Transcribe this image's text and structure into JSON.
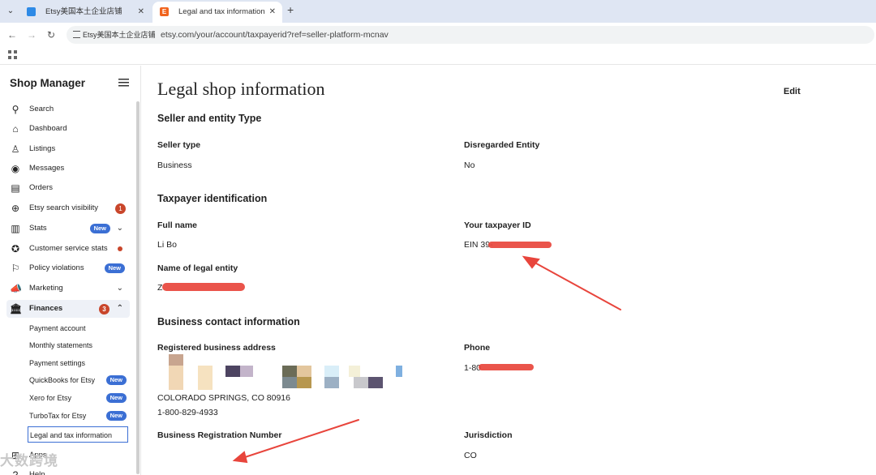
{
  "browser": {
    "tabs": [
      {
        "label": "Etsy美国本土企业店铺",
        "active": false
      },
      {
        "label": "Legal and tax information",
        "active": true
      }
    ],
    "site_chip": "Etsy美国本土企业店铺",
    "url": "etsy.com/your/account/taxpayerid?ref=seller-platform-mcnav"
  },
  "sidebar": {
    "title": "Shop Manager",
    "items": [
      {
        "label": "Search",
        "icon": "search-icon"
      },
      {
        "label": "Dashboard",
        "icon": "home-icon"
      },
      {
        "label": "Listings",
        "icon": "listings-icon"
      },
      {
        "label": "Messages",
        "icon": "messages-icon"
      },
      {
        "label": "Orders",
        "icon": "orders-icon"
      },
      {
        "label": "Etsy search visibility",
        "icon": "search-visibility-icon",
        "badge": "1"
      },
      {
        "label": "Stats",
        "icon": "stats-icon",
        "badge": "New"
      },
      {
        "label": "Customer service stats",
        "icon": "customer-service-icon"
      },
      {
        "label": "Policy violations",
        "icon": "flag-icon",
        "badge": "New"
      },
      {
        "label": "Marketing",
        "icon": "megaphone-icon"
      },
      {
        "label": "Finances",
        "icon": "bank-icon",
        "badge": "3"
      }
    ],
    "finance_sub": [
      {
        "label": "Payment account"
      },
      {
        "label": "Monthly statements"
      },
      {
        "label": "Payment settings"
      },
      {
        "label": "QuickBooks for Etsy",
        "badge": "New"
      },
      {
        "label": "Xero for Etsy",
        "badge": "New"
      },
      {
        "label": "TurboTax for Etsy",
        "badge": "New"
      },
      {
        "label": "Legal and tax information"
      }
    ],
    "apps_label": "Apps",
    "help_label": "Help"
  },
  "main": {
    "title": "Legal shop information",
    "edit_label": "Edit",
    "seller_section": {
      "title": "Seller and entity Type",
      "seller_type_label": "Seller type",
      "seller_type_value": "Business",
      "disregarded_label": "Disregarded Entity",
      "disregarded_value": "No"
    },
    "taxpayer_section": {
      "title": "Taxpayer identification",
      "full_name_label": "Full name",
      "full_name_value": "Li Bo",
      "taxpayer_id_label": "Your taxpayer ID",
      "taxpayer_id_value": "EIN 39-",
      "legal_entity_label": "Name of legal entity",
      "legal_entity_value": "Z"
    },
    "contact_section": {
      "title": "Business contact information",
      "address_label": "Registered business address",
      "address_city": "COLORADO SPRINGS, CO 80916",
      "address_phone": "1-800-829-4933",
      "phone_label": "Phone",
      "phone_value": "1-80",
      "brn_label": "Business Registration Number",
      "jurisdiction_label": "Jurisdiction",
      "jurisdiction_value": "CO"
    }
  },
  "watermark": "大数跨境",
  "colors": {
    "accent_blue": "#3b6fd4",
    "badge_red": "#c9462b",
    "annotation_red": "#e8453c"
  }
}
